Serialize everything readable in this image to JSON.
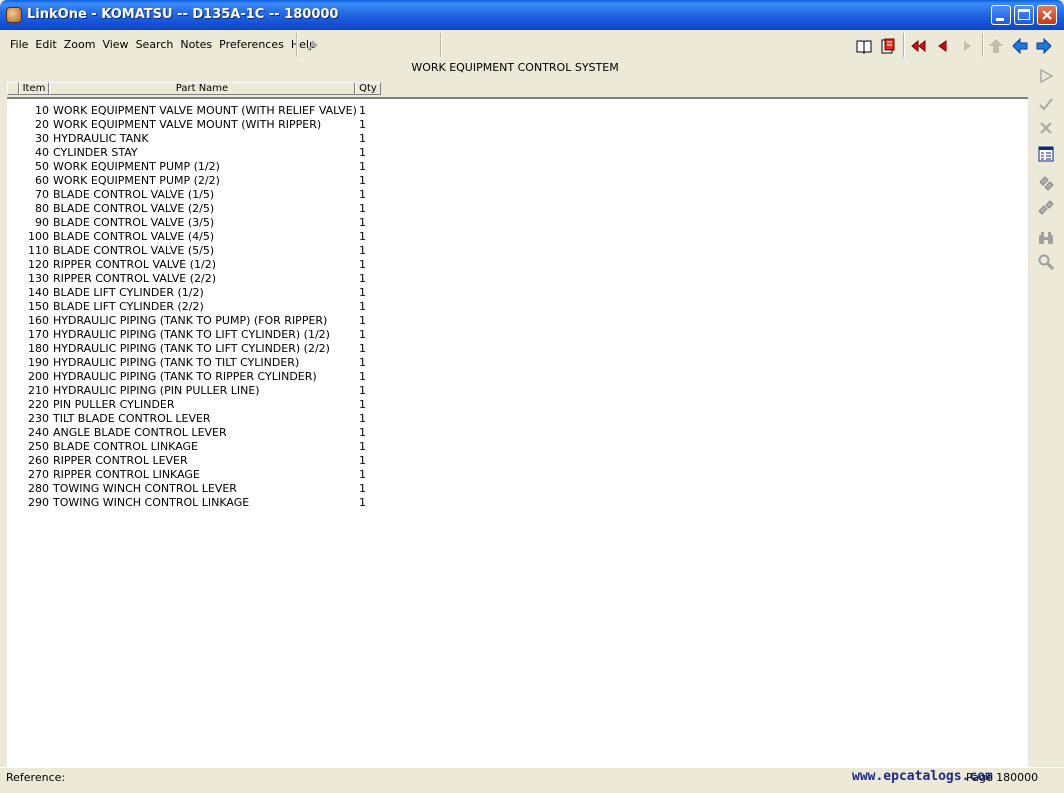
{
  "window": {
    "title": "LinkOne - KOMATSU -- D135A-1C -- 180000"
  },
  "menu": [
    "File",
    "Edit",
    "Zoom",
    "View",
    "Search",
    "Notes",
    "Preferences",
    "Help"
  ],
  "toolbar_icons": [
    "pin-icon",
    "book-icon",
    "print-icon",
    "first-icon",
    "prev-icon",
    "next-icon",
    "up-icon",
    "back-icon",
    "forward-icon"
  ],
  "header": {
    "title": "WORK EQUIPMENT CONTROL SYSTEM"
  },
  "columns": {
    "item": "Item",
    "part_name": "Part Name",
    "qty": "Qty"
  },
  "rows": [
    {
      "item": "10",
      "name": "WORK EQUIPMENT VALVE MOUNT (WITH RELIEF VALVE)",
      "qty": "1"
    },
    {
      "item": "20",
      "name": "WORK EQUIPMENT VALVE MOUNT (WITH RIPPER)",
      "qty": "1"
    },
    {
      "item": "30",
      "name": "HYDRAULIC TANK",
      "qty": "1"
    },
    {
      "item": "40",
      "name": "CYLINDER STAY",
      "qty": "1"
    },
    {
      "item": "50",
      "name": "WORK EQUIPMENT PUMP (1/2)",
      "qty": "1"
    },
    {
      "item": "60",
      "name": "WORK EQUIPMENT PUMP (2/2)",
      "qty": "1"
    },
    {
      "item": "70",
      "name": "BLADE CONTROL VALVE (1/5)",
      "qty": "1"
    },
    {
      "item": "80",
      "name": "BLADE CONTROL VALVE (2/5)",
      "qty": "1"
    },
    {
      "item": "90",
      "name": "BLADE CONTROL VALVE (3/5)",
      "qty": "1"
    },
    {
      "item": "100",
      "name": "BLADE CONTROL VALVE (4/5)",
      "qty": "1"
    },
    {
      "item": "110",
      "name": "BLADE CONTROL VALVE (5/5)",
      "qty": "1"
    },
    {
      "item": "120",
      "name": "RIPPER CONTROL VALVE (1/2)",
      "qty": "1"
    },
    {
      "item": "130",
      "name": "RIPPER CONTROL VALVE (2/2)",
      "qty": "1"
    },
    {
      "item": "140",
      "name": "BLADE LIFT CYLINDER (1/2)",
      "qty": "1"
    },
    {
      "item": "150",
      "name": "BLADE LIFT CYLINDER (2/2)",
      "qty": "1"
    },
    {
      "item": "160",
      "name": "HYDRAULIC PIPING (TANK TO PUMP) (FOR RIPPER)",
      "qty": "1"
    },
    {
      "item": "170",
      "name": "HYDRAULIC PIPING (TANK TO LIFT CYLINDER) (1/2)",
      "qty": "1"
    },
    {
      "item": "180",
      "name": "HYDRAULIC PIPING (TANK TO LIFT CYLINDER) (2/2)",
      "qty": "1"
    },
    {
      "item": "190",
      "name": "HYDRAULIC PIPING (TANK TO TILT CYLINDER)",
      "qty": "1"
    },
    {
      "item": "200",
      "name": "HYDRAULIC PIPING (TANK TO RIPPER CYLINDER)",
      "qty": "1"
    },
    {
      "item": "210",
      "name": "HYDRAULIC PIPING (PIN PULLER LINE)",
      "qty": "1"
    },
    {
      "item": "220",
      "name": "PIN PULLER CYLINDER",
      "qty": "1"
    },
    {
      "item": "230",
      "name": "TILT BLADE CONTROL LEVER",
      "qty": "1"
    },
    {
      "item": "240",
      "name": "ANGLE BLADE CONTROL LEVER",
      "qty": "1"
    },
    {
      "item": "250",
      "name": "BLADE CONTROL LINKAGE",
      "qty": "1"
    },
    {
      "item": "260",
      "name": "RIPPER CONTROL LEVER",
      "qty": "1"
    },
    {
      "item": "270",
      "name": "RIPPER CONTROL LINKAGE",
      "qty": "1"
    },
    {
      "item": "280",
      "name": "TOWING WINCH CONTROL LEVER",
      "qty": "1"
    },
    {
      "item": "290",
      "name": "TOWING WINCH CONTROL LINKAGE",
      "qty": "1"
    }
  ],
  "right_tools": [
    "play-icon",
    "check-icon",
    "cross-icon",
    "list-icon",
    "link-icon",
    "unlink-icon",
    "binoculars-icon",
    "magnifier-icon"
  ],
  "status": {
    "reference": "Reference:",
    "website": "www.epcatalogs.com",
    "page": "Page 180000"
  }
}
